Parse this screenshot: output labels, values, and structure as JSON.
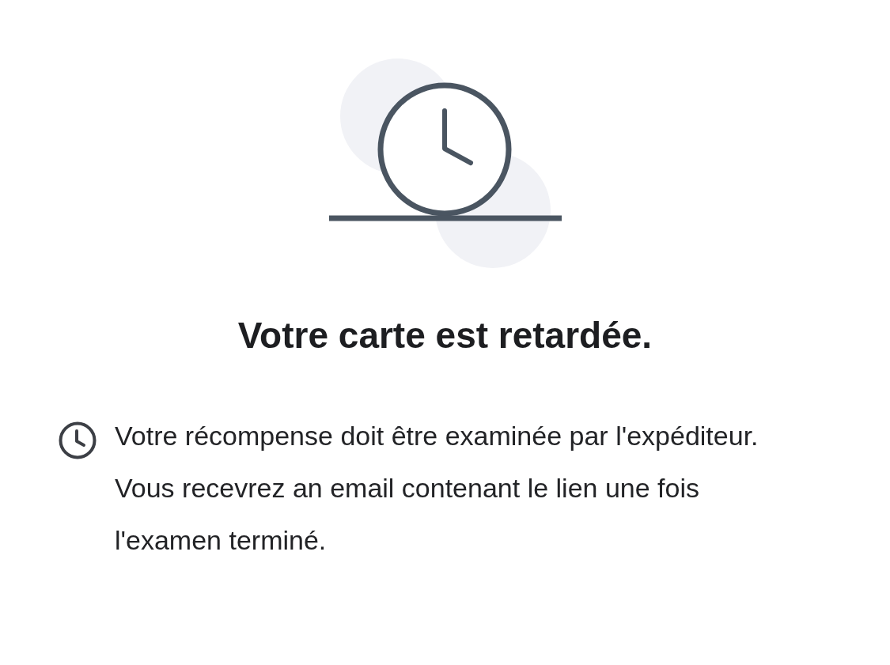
{
  "title": "Votre carte est retardée.",
  "message": "Votre récompense doit être examinée par l'expéditeur. Vous recevrez an email contenant le lien une fois l'examen terminé."
}
